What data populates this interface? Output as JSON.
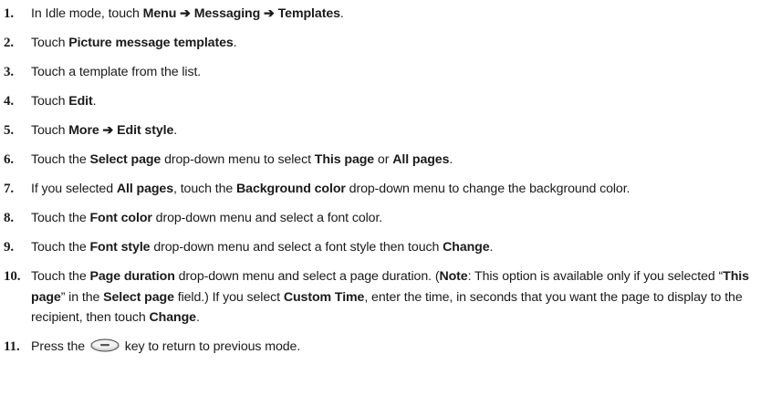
{
  "steps": [
    {
      "num": "1.",
      "parts": [
        {
          "t": "In Idle mode, touch "
        },
        {
          "t": "Menu",
          "b": true
        },
        {
          "t": " ➔ ",
          "b": true
        },
        {
          "t": "Messaging",
          "b": true
        },
        {
          "t": " ➔ ",
          "b": true
        },
        {
          "t": "Templates",
          "b": true
        },
        {
          "t": "."
        }
      ]
    },
    {
      "num": "2.",
      "parts": [
        {
          "t": "Touch "
        },
        {
          "t": "Picture message templates",
          "b": true
        },
        {
          "t": "."
        }
      ]
    },
    {
      "num": "3.",
      "parts": [
        {
          "t": "Touch a template from the list."
        }
      ]
    },
    {
      "num": "4.",
      "parts": [
        {
          "t": "Touch "
        },
        {
          "t": "Edit",
          "b": true
        },
        {
          "t": "."
        }
      ]
    },
    {
      "num": "5.",
      "parts": [
        {
          "t": "Touch "
        },
        {
          "t": "More ➔ Edit style",
          "b": true
        },
        {
          "t": "."
        }
      ]
    },
    {
      "num": "6.",
      "parts": [
        {
          "t": "Touch the "
        },
        {
          "t": "Select page",
          "b": true
        },
        {
          "t": " drop-down menu to select "
        },
        {
          "t": "This page",
          "b": true
        },
        {
          "t": " or "
        },
        {
          "t": "All pages",
          "b": true
        },
        {
          "t": "."
        }
      ]
    },
    {
      "num": "7.",
      "parts": [
        {
          "t": "If you selected "
        },
        {
          "t": "All pages",
          "b": true
        },
        {
          "t": ", touch the "
        },
        {
          "t": "Background color",
          "b": true
        },
        {
          "t": " drop-down menu to change the background color."
        }
      ]
    },
    {
      "num": "8.",
      "parts": [
        {
          "t": "Touch the "
        },
        {
          "t": "Font color",
          "b": true
        },
        {
          "t": " drop-down menu and select a font color."
        }
      ]
    },
    {
      "num": "9.",
      "parts": [
        {
          "t": "Touch the "
        },
        {
          "t": "Font style",
          "b": true
        },
        {
          "t": " drop-down menu and select a font style then touch "
        },
        {
          "t": "Change",
          "b": true
        },
        {
          "t": "."
        }
      ]
    },
    {
      "num": "10.",
      "parts": [
        {
          "t": "Touch the "
        },
        {
          "t": "Page duration",
          "b": true
        },
        {
          "t": " drop-down menu and select a page duration. ("
        },
        {
          "t": "Note",
          "b": true
        },
        {
          "t": ": This option is available only if you selected “"
        },
        {
          "t": "This page",
          "b": true
        },
        {
          "t": "” in the "
        },
        {
          "t": "Select page",
          "b": true
        },
        {
          "t": " field.) If you select "
        },
        {
          "t": "Custom Time",
          "b": true
        },
        {
          "t": ", enter the time, in seconds that you want the page to display to the recipient, then touch "
        },
        {
          "t": "Change",
          "b": true
        },
        {
          "t": "."
        }
      ]
    },
    {
      "num": "11.",
      "parts": [
        {
          "t": "Press the "
        },
        {
          "icon": "end-call-key-icon"
        },
        {
          "t": " key to return to previous mode."
        }
      ]
    }
  ]
}
